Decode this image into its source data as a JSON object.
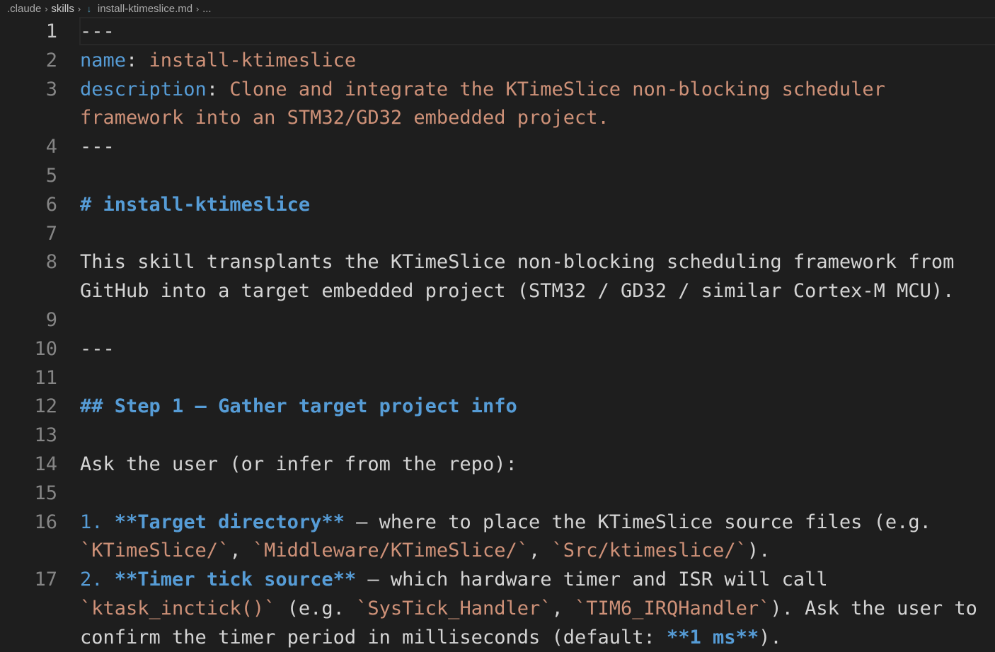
{
  "breadcrumb": {
    "items": [
      ".claude",
      "skills",
      "install-ktimeslice.md",
      "..."
    ],
    "separator": "›"
  },
  "editor": {
    "current_line": 1,
    "lines": [
      {
        "n": "1",
        "segments": [
          {
            "t": "---",
            "c": "txt"
          }
        ]
      },
      {
        "n": "2",
        "segments": [
          {
            "t": "name",
            "c": "key"
          },
          {
            "t": ": ",
            "c": "punc"
          },
          {
            "t": "install-ktimeslice",
            "c": "val"
          }
        ]
      },
      {
        "n": "3",
        "segments": [
          {
            "t": "description",
            "c": "key"
          },
          {
            "t": ": ",
            "c": "punc"
          },
          {
            "t": "Clone and integrate the KTimeSlice non-blocking scheduler",
            "c": "val"
          }
        ]
      },
      {
        "n": "",
        "segments": [
          {
            "t": "framework into an STM32/GD32 embedded project.",
            "c": "val"
          }
        ]
      },
      {
        "n": "4",
        "segments": [
          {
            "t": "---",
            "c": "txt"
          }
        ]
      },
      {
        "n": "5",
        "segments": []
      },
      {
        "n": "6",
        "segments": [
          {
            "t": "# install-ktimeslice",
            "c": "head"
          }
        ]
      },
      {
        "n": "7",
        "segments": []
      },
      {
        "n": "8",
        "segments": [
          {
            "t": "This skill transplants the KTimeSlice non-blocking scheduling framework from",
            "c": "txt"
          }
        ]
      },
      {
        "n": "",
        "segments": [
          {
            "t": "GitHub into a target embedded project (STM32 / GD32 / similar Cortex-M MCU).",
            "c": "txt"
          }
        ]
      },
      {
        "n": "9",
        "segments": []
      },
      {
        "n": "10",
        "segments": [
          {
            "t": "---",
            "c": "txt"
          }
        ]
      },
      {
        "n": "11",
        "segments": []
      },
      {
        "n": "12",
        "segments": [
          {
            "t": "## Step 1 — Gather target project info",
            "c": "head"
          }
        ]
      },
      {
        "n": "13",
        "segments": []
      },
      {
        "n": "14",
        "segments": [
          {
            "t": "Ask the user (or infer from the repo):",
            "c": "txt"
          }
        ]
      },
      {
        "n": "15",
        "segments": []
      },
      {
        "n": "16",
        "segments": [
          {
            "t": "1. ",
            "c": "key"
          },
          {
            "t": "**Target directory**",
            "c": "bold"
          },
          {
            "t": " — where to place the KTimeSlice source files (e.g.",
            "c": "txt"
          }
        ]
      },
      {
        "n": "",
        "segments": [
          {
            "t": "`KTimeSlice/`",
            "c": "code"
          },
          {
            "t": ", ",
            "c": "txt"
          },
          {
            "t": "`Middleware/KTimeSlice/`",
            "c": "code"
          },
          {
            "t": ", ",
            "c": "txt"
          },
          {
            "t": "`Src/ktimeslice/`",
            "c": "code"
          },
          {
            "t": ").",
            "c": "txt"
          }
        ]
      },
      {
        "n": "17",
        "segments": [
          {
            "t": "2. ",
            "c": "key"
          },
          {
            "t": "**Timer tick source**",
            "c": "bold"
          },
          {
            "t": " — which hardware timer and ISR will call",
            "c": "txt"
          }
        ]
      },
      {
        "n": "",
        "segments": [
          {
            "t": "`ktask_inctick()`",
            "c": "code"
          },
          {
            "t": " (e.g. ",
            "c": "txt"
          },
          {
            "t": "`SysTick_Handler`",
            "c": "code"
          },
          {
            "t": ", ",
            "c": "txt"
          },
          {
            "t": "`TIM6_IRQHandler`",
            "c": "code"
          },
          {
            "t": "). Ask the user to",
            "c": "txt"
          }
        ]
      },
      {
        "n": "",
        "segments": [
          {
            "t": "confirm the timer period in milliseconds (default: ",
            "c": "txt"
          },
          {
            "t": "**1 ms**",
            "c": "bold"
          },
          {
            "t": ").",
            "c": "txt"
          }
        ]
      }
    ]
  }
}
